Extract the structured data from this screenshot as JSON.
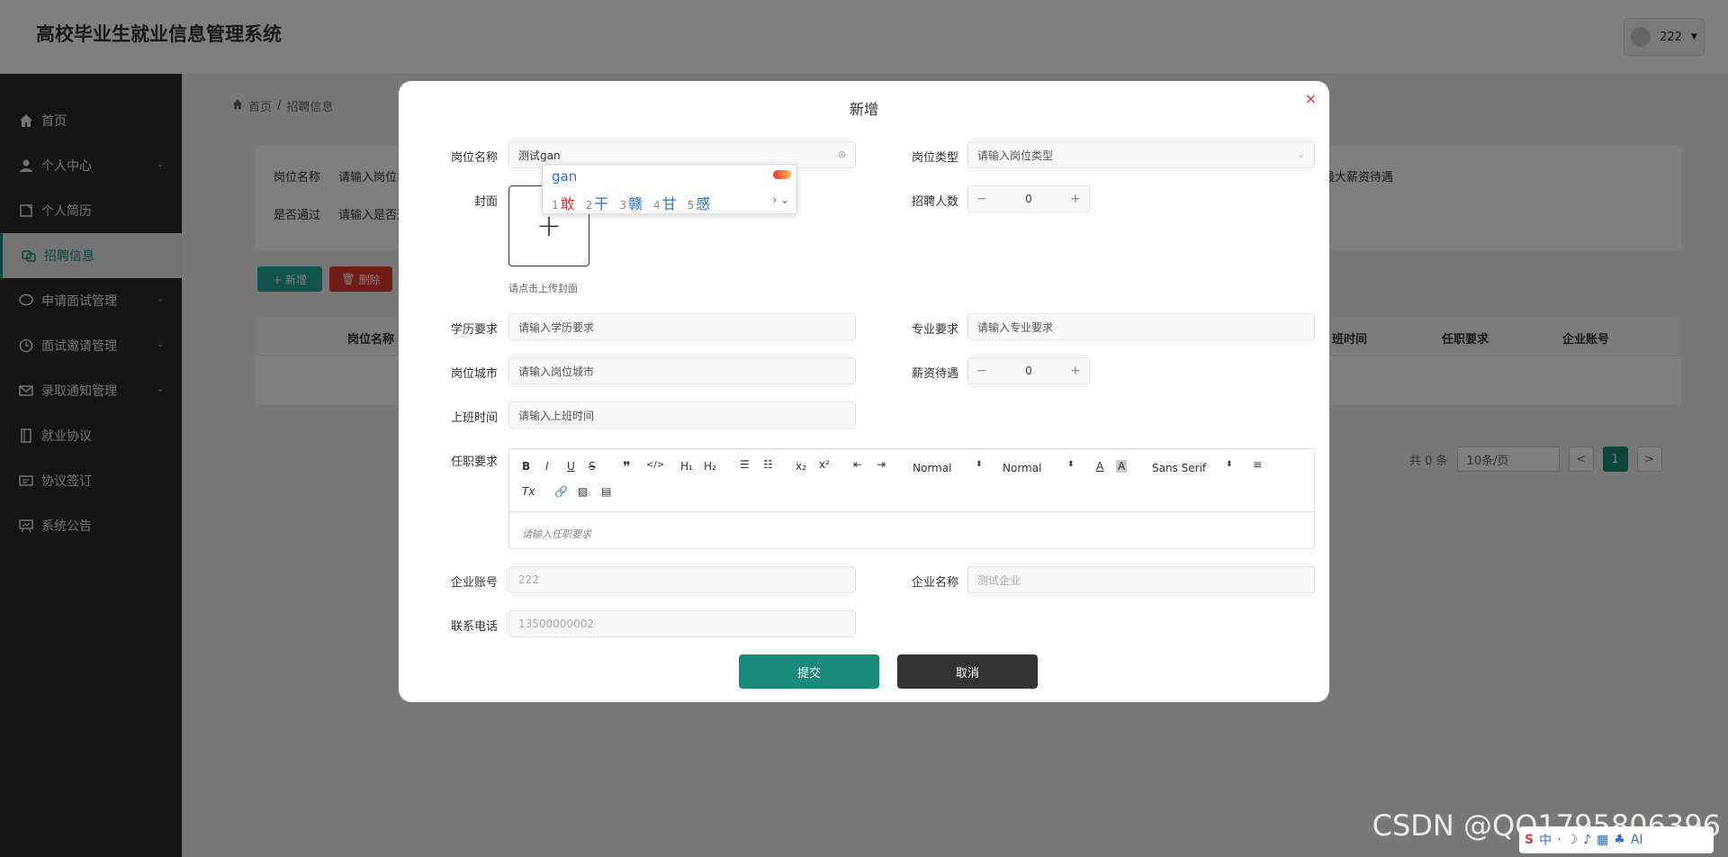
{
  "app": {
    "title": "高校毕业生就业信息管理系统",
    "user": "222"
  },
  "sidebar": {
    "items": [
      {
        "label": "首页",
        "icon": "home-icon",
        "expand": false
      },
      {
        "label": "个人中心",
        "icon": "user-icon",
        "expand": true
      },
      {
        "label": "个人简历",
        "icon": "resume-icon",
        "expand": false
      },
      {
        "label": "招聘信息",
        "icon": "recruit-icon",
        "expand": false,
        "active": true
      },
      {
        "label": "申请面试管理",
        "icon": "chat-icon",
        "expand": true
      },
      {
        "label": "面试邀请管理",
        "icon": "clock-icon",
        "expand": true
      },
      {
        "label": "录取通知管理",
        "icon": "mail-icon",
        "expand": true
      },
      {
        "label": "就业协议",
        "icon": "doc-icon",
        "expand": false
      },
      {
        "label": "协议签订",
        "icon": "sign-icon",
        "expand": false
      },
      {
        "label": "系统公告",
        "icon": "notice-icon",
        "expand": false
      }
    ]
  },
  "breadcrumb": {
    "home": "首页",
    "sep": "/",
    "current": "招聘信息"
  },
  "search": {
    "label1": "岗位名称",
    "ph1": "请输入岗位名",
    "label2": "是否通过",
    "ph2": "请输入是否通",
    "tail": "最大薪资待遇"
  },
  "actions": {
    "add": "+ 新增",
    "del": "删除"
  },
  "table": {
    "headers": [
      "岗位名称",
      "班时间",
      "任职要求",
      "企业账号"
    ]
  },
  "pager": {
    "total": "共 0 条",
    "size": "10条/页",
    "prev": "<",
    "page": "1",
    "next": ">"
  },
  "modal": {
    "title": "新增",
    "close": "×",
    "fields": {
      "job_name": {
        "label": "岗位名称",
        "value": "测试gan"
      },
      "job_type": {
        "label": "岗位类型",
        "placeholder": "请输入岗位类型"
      },
      "cover": {
        "label": "封面",
        "hint": "请点击上传封面"
      },
      "headcount": {
        "label": "招聘人数",
        "value": "0"
      },
      "education": {
        "label": "学历要求",
        "placeholder": "请输入学历要求"
      },
      "major": {
        "label": "专业要求",
        "placeholder": "请输入专业要求"
      },
      "city": {
        "label": "岗位城市",
        "placeholder": "请输入岗位城市"
      },
      "salary": {
        "label": "薪资待遇",
        "value": "0"
      },
      "work_time": {
        "label": "上班时间",
        "placeholder": "请输入上班时间"
      },
      "requirements": {
        "label": "任职要求",
        "placeholder": "请输入任职要求"
      },
      "company_account": {
        "label": "企业账号",
        "value": "222"
      },
      "company_name": {
        "label": "企业名称",
        "value": "测试企业"
      },
      "phone": {
        "label": "联系电话",
        "value": "13500000002"
      }
    },
    "editor": {
      "header1": "Normal",
      "header2": "Normal",
      "font": "Sans Serif"
    },
    "submit": "提交",
    "cancel": "取消"
  },
  "ime": {
    "pinyin": "gan",
    "candidates": [
      {
        "n": "1",
        "c": "敢"
      },
      {
        "n": "2",
        "c": "干"
      },
      {
        "n": "3",
        "c": "赣"
      },
      {
        "n": "4",
        "c": "甘"
      },
      {
        "n": "5",
        "c": "感"
      }
    ]
  },
  "watermark": "CSDN @QQ1795806396"
}
